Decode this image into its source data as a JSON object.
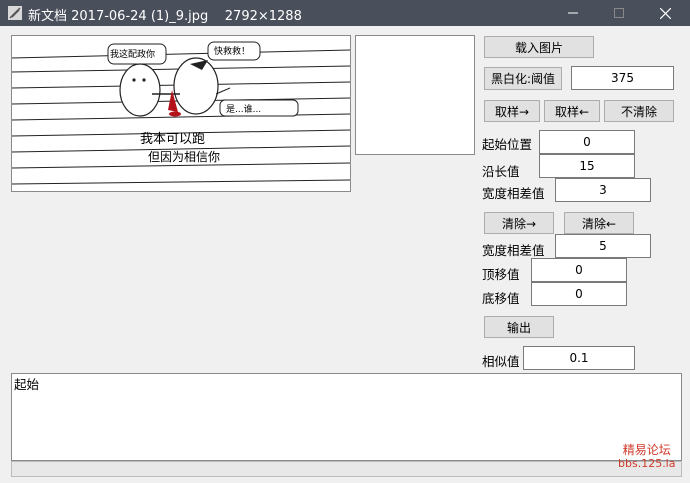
{
  "window": {
    "title": "新文档 2017-06-24 (1)_9.jpg    2792×1288",
    "icons": {
      "app": "app-feather-icon",
      "minimize": "minimize-icon",
      "maximize": "maximize-icon",
      "close": "close-icon"
    }
  },
  "image": {
    "speech_left": "我这配政你",
    "speech_right": "快救救！",
    "speech_bottom": "是...谁...",
    "caption_line1": "我本可以跑",
    "caption_line2": "但因为相信你"
  },
  "controls": {
    "load_image": "载入图片",
    "binarize_label": "黑白化:阈值",
    "binarize_value": "375",
    "sample_right": "取样→",
    "sample_left": "取样←",
    "no_clear": "不清除",
    "start_pos_label": "起始位置",
    "start_pos_value": "0",
    "edge_label": "沿长值",
    "edge_value": "15",
    "width_diff_label": "宽度相差值",
    "width_diff_value": "3",
    "clear_right": "清除→",
    "clear_left": "清除←",
    "width_diff2_label": "宽度相差值",
    "width_diff2_value": "5",
    "top_shift_label": "顶移值",
    "top_shift_value": "0",
    "bottom_shift_label": "底移值",
    "bottom_shift_value": "0",
    "output": "输出",
    "similarity_label": "相似值",
    "similarity_value": "0.1"
  },
  "log": {
    "text": "起始"
  },
  "watermark": {
    "line1": "精易论坛",
    "line2": "bbs.125.la"
  }
}
